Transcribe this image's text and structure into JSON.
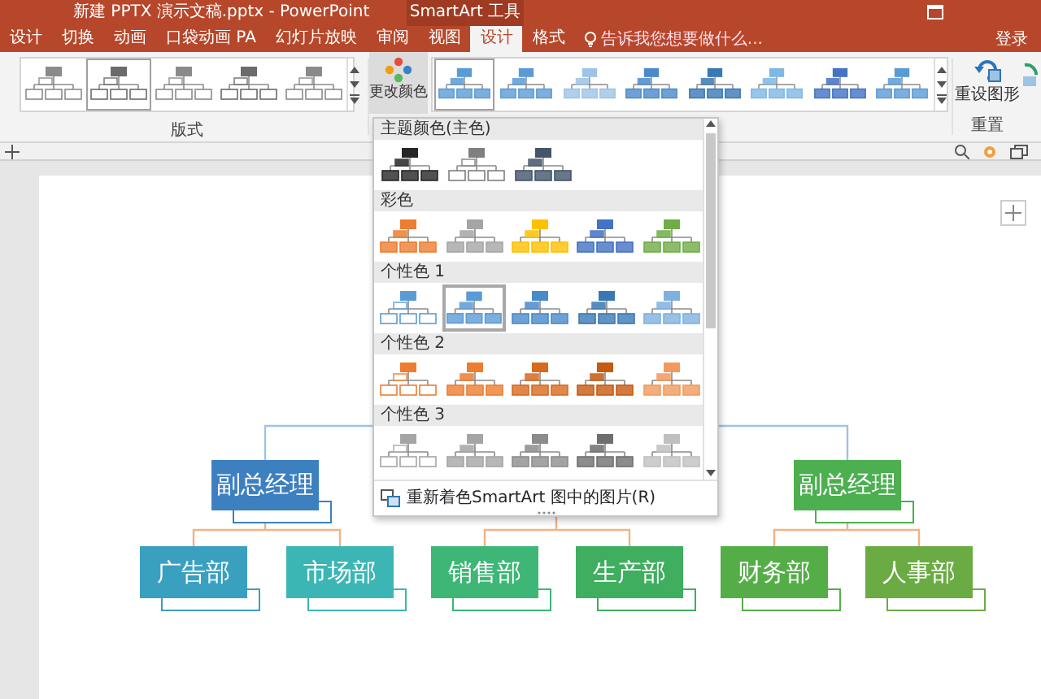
{
  "window": {
    "title": "新建 PPTX 演示文稿.pptx - PowerPoint",
    "context_tab_group": "SmartArt 工具"
  },
  "tabs": [
    {
      "label": "设计",
      "selected": false
    },
    {
      "label": "切换",
      "selected": false
    },
    {
      "label": "动画",
      "selected": false
    },
    {
      "label": "口袋动画 PA",
      "selected": false
    },
    {
      "label": "幻灯片放映",
      "selected": false
    },
    {
      "label": "审阅",
      "selected": false
    },
    {
      "label": "视图",
      "selected": false
    },
    {
      "label": "设计",
      "selected": true
    },
    {
      "label": "格式",
      "selected": false
    }
  ],
  "tell_me": {
    "placeholder": "告诉我您想要做什么..."
  },
  "sign_in": "登录",
  "ribbon": {
    "layouts": {
      "label": "版式",
      "items": [
        {
          "selected": false
        },
        {
          "selected": true
        },
        {
          "selected": false
        },
        {
          "selected": false
        },
        {
          "selected": false
        }
      ]
    },
    "change_colors": {
      "label": "更改颜色"
    },
    "styles": {
      "items": [
        {
          "selected": true
        },
        {
          "selected": false
        },
        {
          "selected": false
        },
        {
          "selected": false
        },
        {
          "selected": false
        },
        {
          "selected": false
        },
        {
          "selected": false
        },
        {
          "selected": false
        }
      ]
    },
    "reset": {
      "button": "重设图形",
      "label": "重置"
    }
  },
  "color_menu": {
    "sections": [
      {
        "label": "主题颜色(主色)",
        "options": [
          {
            "kind": "fill",
            "color": "#262626",
            "selected": false
          },
          {
            "kind": "outline",
            "color": "#7f7f7f",
            "selected": false
          },
          {
            "kind": "fill",
            "color": "#44546a",
            "selected": false
          }
        ]
      },
      {
        "label": "彩色",
        "options": [
          {
            "kind": "fill",
            "color": "#ed7d31",
            "selected": false
          },
          {
            "kind": "fill",
            "color": "#a5a5a5",
            "selected": false
          },
          {
            "kind": "fill",
            "color": "#ffc000",
            "selected": false
          },
          {
            "kind": "fill",
            "color": "#4472c4",
            "selected": false
          },
          {
            "kind": "fill",
            "color": "#70ad47",
            "selected": false
          }
        ]
      },
      {
        "label": "个性色 1",
        "options": [
          {
            "kind": "outline",
            "color": "#5b9bd5",
            "selected": false
          },
          {
            "kind": "fill",
            "color": "#5b9bd5",
            "selected": true
          },
          {
            "kind": "fill",
            "color": "#4a8ac8",
            "selected": false
          },
          {
            "kind": "fill",
            "color": "#3a78b5",
            "selected": false
          },
          {
            "kind": "fill",
            "color": "#7eb1df",
            "selected": false
          }
        ]
      },
      {
        "label": "个性色 2",
        "options": [
          {
            "kind": "outline",
            "color": "#ed7d31",
            "selected": false
          },
          {
            "kind": "fill",
            "color": "#ed7d31",
            "selected": false
          },
          {
            "kind": "fill",
            "color": "#d86a1e",
            "selected": false
          },
          {
            "kind": "fill",
            "color": "#c55a11",
            "selected": false
          },
          {
            "kind": "fill",
            "color": "#f19a5c",
            "selected": false
          }
        ]
      },
      {
        "label": "个性色 3",
        "options": [
          {
            "kind": "outline",
            "color": "#a5a5a5",
            "selected": false
          },
          {
            "kind": "fill",
            "color": "#a5a5a5",
            "selected": false
          },
          {
            "kind": "fill",
            "color": "#8c8c8c",
            "selected": false
          },
          {
            "kind": "fill",
            "color": "#6f6f6f",
            "selected": false
          },
          {
            "kind": "fill",
            "color": "#c0c0c0",
            "selected": false
          }
        ]
      }
    ],
    "footer": "重新着色SmartArt 图中的图片(R)"
  },
  "org_chart": {
    "groups": [
      {
        "title": "副总经理",
        "color": "#3d80c0",
        "children": [
          {
            "text": "广告部",
            "color": "#3aa0c0"
          },
          {
            "text": "市场部",
            "color": "#3bb6b4"
          }
        ]
      },
      {
        "children": [
          {
            "text": "销售部",
            "color": "#3db676"
          },
          {
            "text": "生产部",
            "color": "#3fae5e"
          }
        ]
      },
      {
        "title": "副总经理",
        "color": "#4caf50",
        "children": [
          {
            "text": "财务部",
            "color": "#55ad48"
          },
          {
            "text": "人事部",
            "color": "#6aab44"
          }
        ]
      }
    ]
  }
}
